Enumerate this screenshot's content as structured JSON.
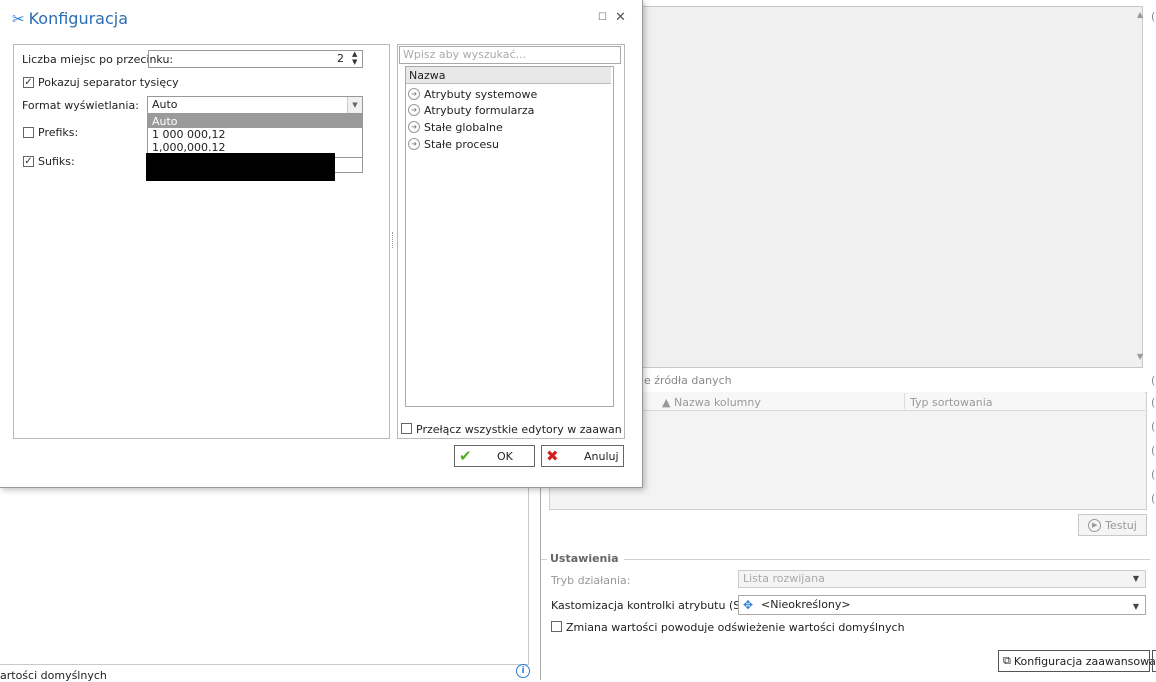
{
  "dialog": {
    "title": "Konfiguracja",
    "fields": {
      "decimal_label": "Liczba miejsc po przecinku:",
      "decimal_value": "2",
      "separator_label": "Pokazuj separator tysięcy",
      "separator_checked": true,
      "format_label": "Format wyświetlania:",
      "format_value": "Auto",
      "format_options": [
        "Auto",
        "1 000 000,12",
        "1,000,000.12"
      ],
      "prefix_label": "Prefiks:",
      "prefix_checked": false,
      "suffix_label": "Sufiks:",
      "suffix_checked": true
    },
    "search_placeholder": "Wpisz aby wyszukać...",
    "tree": {
      "header": "Nazwa",
      "items": [
        "Atrybuty systemowe",
        "Atrybuty formularza",
        "Stałe globalne",
        "Stałe procesu"
      ]
    },
    "switch_label": "Przełącz wszystkie edytory w zaawansowan...",
    "ok_label": "OK",
    "cancel_label": "Anuluj"
  },
  "background": {
    "bottom_left_text": "artości domyślnych",
    "datasource_label": "e źródła danych",
    "columns": [
      "Nazwa kolumny",
      "Typ sortowania"
    ],
    "test_label": "Testuj",
    "settings_title": "Ustawienia",
    "mode_label": "Tryb działania:",
    "mode_value": "Lista rozwijana",
    "sdk_label": "Kastomizacja kontrolki atrybutu (SDK):",
    "sdk_value": "<Nieokreślony>",
    "refresh_label": "Zmiana wartości powoduje odświeżenie wartości domyślnych",
    "advanced_config_label": "Konfiguracja zaawansowana"
  },
  "colors": {
    "title_blue": "#2a6db5",
    "ok_green": "#4caf22",
    "cancel_red": "#d42020"
  }
}
